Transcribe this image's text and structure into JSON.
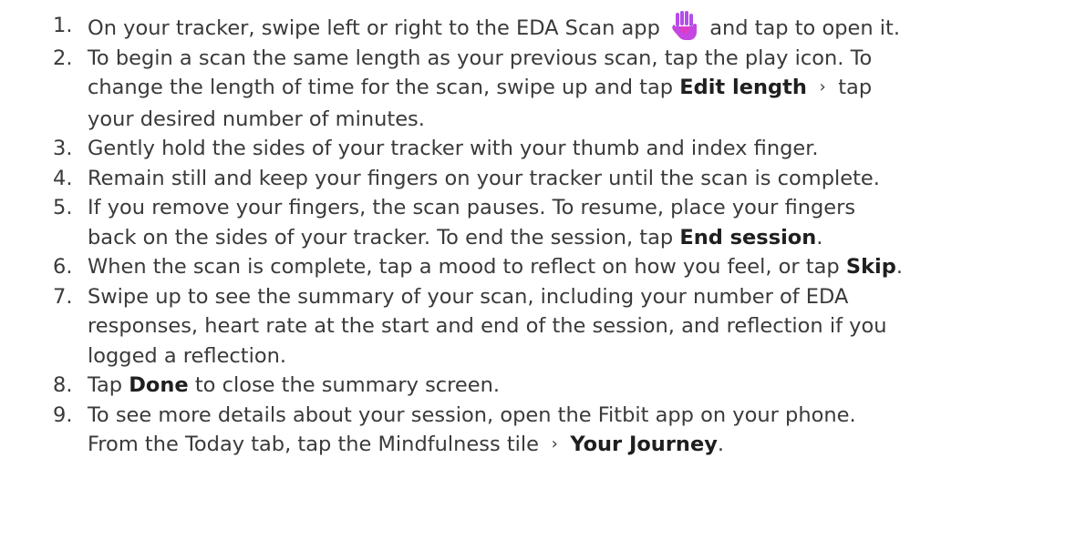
{
  "steps": [
    {
      "number": "1.",
      "a": "On your tracker, swipe left or right to the EDA Scan app",
      "icon": "hand-with-heart-icon",
      "b": "and tap to open it."
    },
    {
      "number": "2.",
      "line1": "To begin a scan the same length as your previous scan, tap the play icon. To",
      "a": "change the length of time for the scan, swipe up and tap",
      "bold": "Edit length",
      "b": "tap",
      "line3": "your desired number of minutes."
    },
    {
      "number": "3.",
      "text": "Gently hold the sides of your tracker with your thumb and index finger."
    },
    {
      "number": "4.",
      "text": "Remain still and keep your fingers on your tracker until the scan is complete."
    },
    {
      "number": "5.",
      "line1": "If you remove your fingers, the scan pauses. To resume, place your fingers",
      "a": "back on the sides of your tracker. To end the session, tap",
      "bold": "End session",
      "b": "."
    },
    {
      "number": "6.",
      "a": "When the scan is complete, tap a mood to reflect on how you feel, or tap",
      "bold": "Skip",
      "b": "."
    },
    {
      "number": "7.",
      "line1": "Swipe up to see the summary of your scan, including your number of EDA",
      "line2": "responses, heart rate at the start and end of the session, and reflection if you",
      "line3": "logged a reflection."
    },
    {
      "number": "8.",
      "a": "Tap",
      "bold": "Done",
      "b": "to close the summary screen."
    },
    {
      "number": "9.",
      "line1": "To see more details about your session, open the Fitbit app on your phone.",
      "a": "From the Today tab, tap the Mindfulness tile",
      "bold": "Your Journey",
      "b": "."
    }
  ],
  "glyphs": {
    "chevron": "›"
  },
  "colors": {
    "text": "#3a3a3a",
    "icon_purple": "#b44de8",
    "icon_magenta": "#e03cc8"
  }
}
